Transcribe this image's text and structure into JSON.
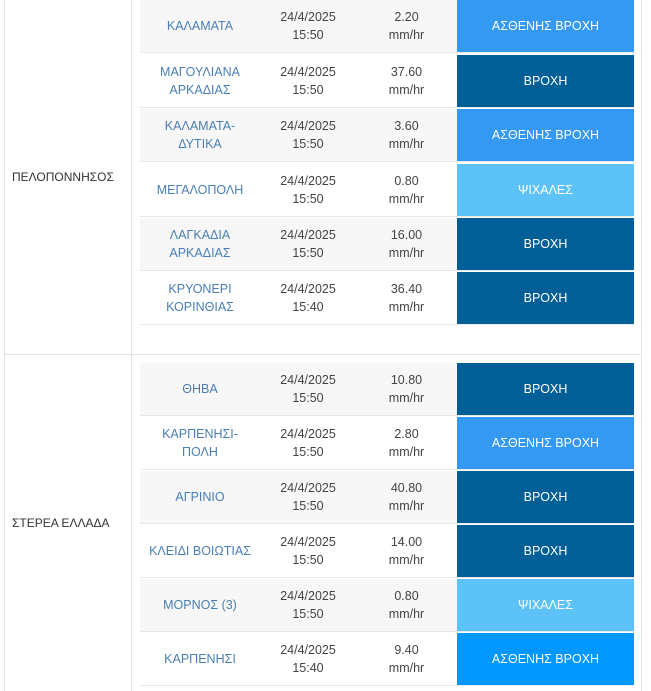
{
  "regions": [
    {
      "name": "ΠΕΛΟΠΟΝΝΗΣΟΣ",
      "rows": [
        {
          "station": "ΚΑΛΑΜΑΤΑ",
          "date": "24/4/2025",
          "time": "15:50",
          "value": "2.20",
          "unit": "mm/hr",
          "status": "ΑΣΘΕΝΗΣ ΒΡΟΧΗ",
          "color": "#3399f3"
        },
        {
          "station_l1": "ΜΑΓΟΥΛΙΑΝΑ",
          "station_l2": "ΑΡΚΑΔΙΑΣ",
          "date": "24/4/2025",
          "time": "15:50",
          "value": "37.60",
          "unit": "mm/hr",
          "status": "ΒΡΟΧΗ",
          "color": "#005f96"
        },
        {
          "station_l1": "ΚΑΛΑΜΑΤΑ-",
          "station_l2": "ΔΥΤΙΚΑ",
          "date": "24/4/2025",
          "time": "15:50",
          "value": "3.60",
          "unit": "mm/hr",
          "status": "ΑΣΘΕΝΗΣ ΒΡΟΧΗ",
          "color": "#3399f3"
        },
        {
          "station": "ΜΕΓΑΛΟΠΟΛΗ",
          "date": "24/4/2025",
          "time": "15:50",
          "value": "0.80",
          "unit": "mm/hr",
          "status": "ΨΙΧΑΛΕΣ",
          "color": "#5cc2f7"
        },
        {
          "station_l1": "ΛΑΓΚΑΔΙΑ",
          "station_l2": "ΑΡΚΑΔΙΑΣ",
          "date": "24/4/2025",
          "time": "15:50",
          "value": "16.00",
          "unit": "mm/hr",
          "status": "ΒΡΟΧΗ",
          "color": "#005f96"
        },
        {
          "station_l1": "ΚΡΥΟΝΕΡΙ",
          "station_l2": "ΚΟΡΙΝΘΙΑΣ",
          "date": "24/4/2025",
          "time": "15:40",
          "value": "36.40",
          "unit": "mm/hr",
          "status": "ΒΡΟΧΗ",
          "color": "#005f96"
        }
      ]
    },
    {
      "name": "ΣΤΕΡΕΑ ΕΛΛΑΔΑ",
      "rows": [
        {
          "station": "ΘΗΒΑ",
          "date": "24/4/2025",
          "time": "15:50",
          "value": "10.80",
          "unit": "mm/hr",
          "status": "ΒΡΟΧΗ",
          "color": "#005f96"
        },
        {
          "station_l1": "ΚΑΡΠΕΝΗΣΙ-",
          "station_l2": "ΠΟΛΗ",
          "date": "24/4/2025",
          "time": "15:50",
          "value": "2.80",
          "unit": "mm/hr",
          "status": "ΑΣΘΕΝΗΣ ΒΡΟΧΗ",
          "color": "#3399f3"
        },
        {
          "station": "ΑΓΡΙΝΙΟ",
          "date": "24/4/2025",
          "time": "15:50",
          "value": "40.80",
          "unit": "mm/hr",
          "status": "ΒΡΟΧΗ",
          "color": "#005f96"
        },
        {
          "station": "ΚΛΕΙΔΙ ΒΟΙΩΤΙΑΣ",
          "date": "24/4/2025",
          "time": "15:50",
          "value": "14.00",
          "unit": "mm/hr",
          "status": "ΒΡΟΧΗ",
          "color": "#005f96"
        },
        {
          "station": "ΜΟΡΝΟΣ (3)",
          "date": "24/4/2025",
          "time": "15:50",
          "value": "0.80",
          "unit": "mm/hr",
          "status": "ΨΙΧΑΛΕΣ",
          "color": "#5cc2f7"
        },
        {
          "station": "ΚΑΡΠΕΝΗΣΙ",
          "date": "24/4/2025",
          "time": "15:40",
          "value": "9.40",
          "unit": "mm/hr",
          "status": "ΑΣΘΕΝΗΣ ΒΡΟΧΗ",
          "color": "#0098fe"
        }
      ]
    }
  ]
}
